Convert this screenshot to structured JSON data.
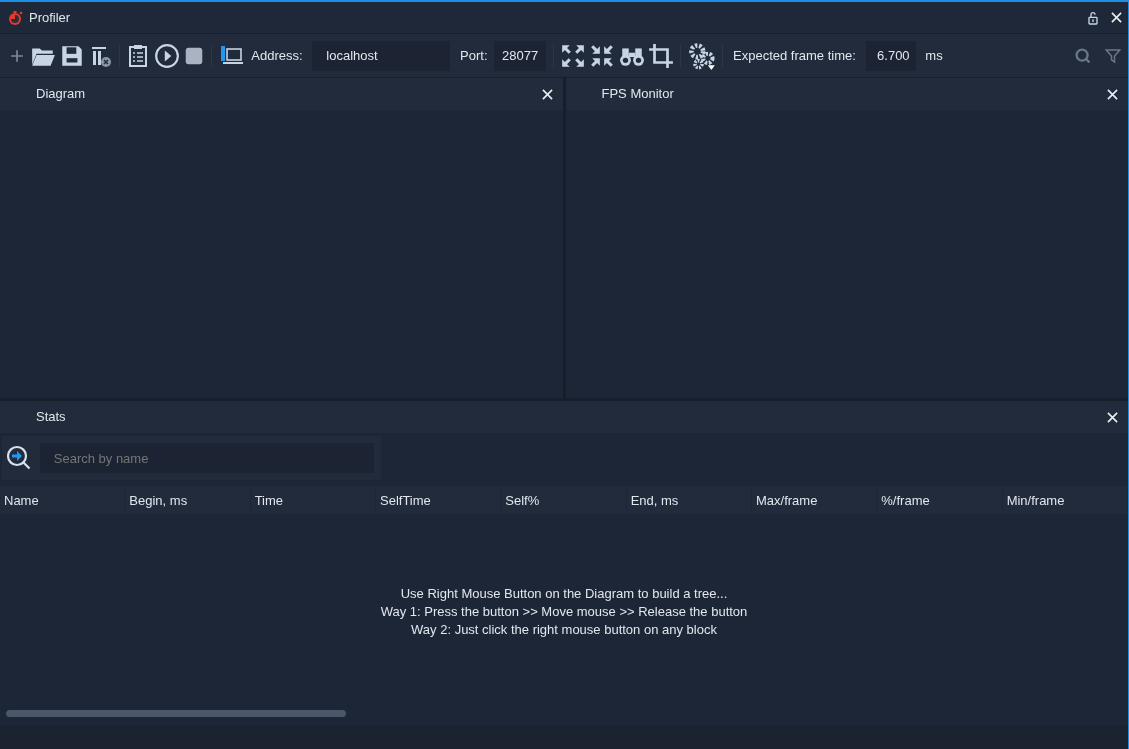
{
  "window": {
    "title": "Profiler"
  },
  "toolbar": {
    "address_label": "Address:",
    "address": "localhost",
    "port_label": "Port:",
    "port": "28077",
    "frame_time_label": "Expected frame time:",
    "frame_time": "6.700",
    "frame_time_unit": "ms"
  },
  "panels": [
    {
      "title": "Diagram"
    },
    {
      "title": "FPS Monitor"
    }
  ],
  "stats": {
    "title": "Stats",
    "search": {
      "placeholder": "Search by name"
    },
    "columns": [
      "Name",
      "Begin, ms",
      "Time",
      "SelfTime",
      "Self%",
      "End, ms",
      "Max/frame",
      "%/frame",
      "Min/frame"
    ],
    "hint_lines": [
      "Use Right Mouse Button on the Diagram to build a tree...",
      "Way 1: Press the button >> Move mouse >> Release the button",
      "Way 2: Just click the right mouse button on any block"
    ]
  }
}
